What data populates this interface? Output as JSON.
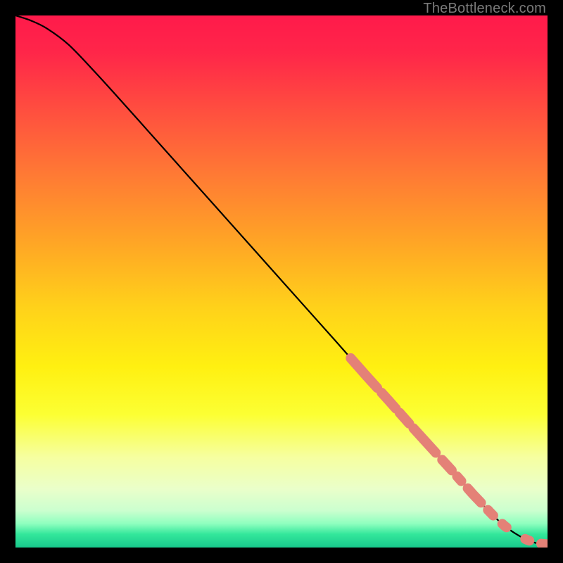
{
  "watermark": "TheBottleneck.com",
  "chart_data": {
    "type": "line",
    "title": "",
    "xlabel": "",
    "ylabel": "",
    "xlim": [
      0,
      100
    ],
    "ylim": [
      0,
      100
    ],
    "background_gradient": {
      "stops": [
        {
          "offset": 0.0,
          "color": "#ff1a4b"
        },
        {
          "offset": 0.07,
          "color": "#ff2649"
        },
        {
          "offset": 0.18,
          "color": "#ff4f3f"
        },
        {
          "offset": 0.3,
          "color": "#ff7a34"
        },
        {
          "offset": 0.42,
          "color": "#ffa326"
        },
        {
          "offset": 0.55,
          "color": "#ffd21a"
        },
        {
          "offset": 0.66,
          "color": "#fff011"
        },
        {
          "offset": 0.75,
          "color": "#fcff33"
        },
        {
          "offset": 0.83,
          "color": "#f6ffa0"
        },
        {
          "offset": 0.89,
          "color": "#eaffca"
        },
        {
          "offset": 0.93,
          "color": "#ccffcf"
        },
        {
          "offset": 0.955,
          "color": "#8fffbf"
        },
        {
          "offset": 0.975,
          "color": "#33e79b"
        },
        {
          "offset": 1.0,
          "color": "#18c98c"
        }
      ]
    },
    "curve": {
      "comment": "Monotone decreasing line from top-left to bottom-right; values are percentage of something (y) vs percentage of x, read off the plot.",
      "x": [
        0,
        3,
        6,
        10,
        15,
        20,
        25,
        30,
        35,
        40,
        45,
        50,
        55,
        60,
        63,
        66,
        70,
        74,
        78,
        82,
        86,
        90,
        92,
        94,
        96,
        98,
        100
      ],
      "y": [
        100,
        99,
        97.5,
        94.5,
        89.3,
        83.8,
        78.2,
        72.6,
        67.0,
        61.4,
        55.8,
        50.2,
        44.6,
        39.0,
        35.6,
        32.2,
        27.8,
        23.3,
        18.9,
        14.5,
        10.0,
        5.8,
        4.0,
        2.6,
        1.5,
        0.8,
        0.6
      ]
    },
    "highlight_segments": {
      "comment": "Thick salmon segments overlaid on the lower-right portion of the curve.",
      "color": "#e48177",
      "segments": [
        {
          "x0": 63.0,
          "x1": 68.0
        },
        {
          "x0": 68.8,
          "x1": 71.5
        },
        {
          "x0": 72.2,
          "x1": 74.0
        },
        {
          "x0": 74.8,
          "x1": 79.0
        },
        {
          "x0": 80.2,
          "x1": 82.0
        },
        {
          "x0": 83.0,
          "x1": 83.8
        },
        {
          "x0": 85.0,
          "x1": 87.5
        },
        {
          "x0": 88.8,
          "x1": 89.8
        },
        {
          "x0": 91.5,
          "x1": 92.3
        },
        {
          "x0": 95.8,
          "x1": 96.6
        },
        {
          "x0": 98.8,
          "x1": 100.0
        }
      ]
    }
  }
}
